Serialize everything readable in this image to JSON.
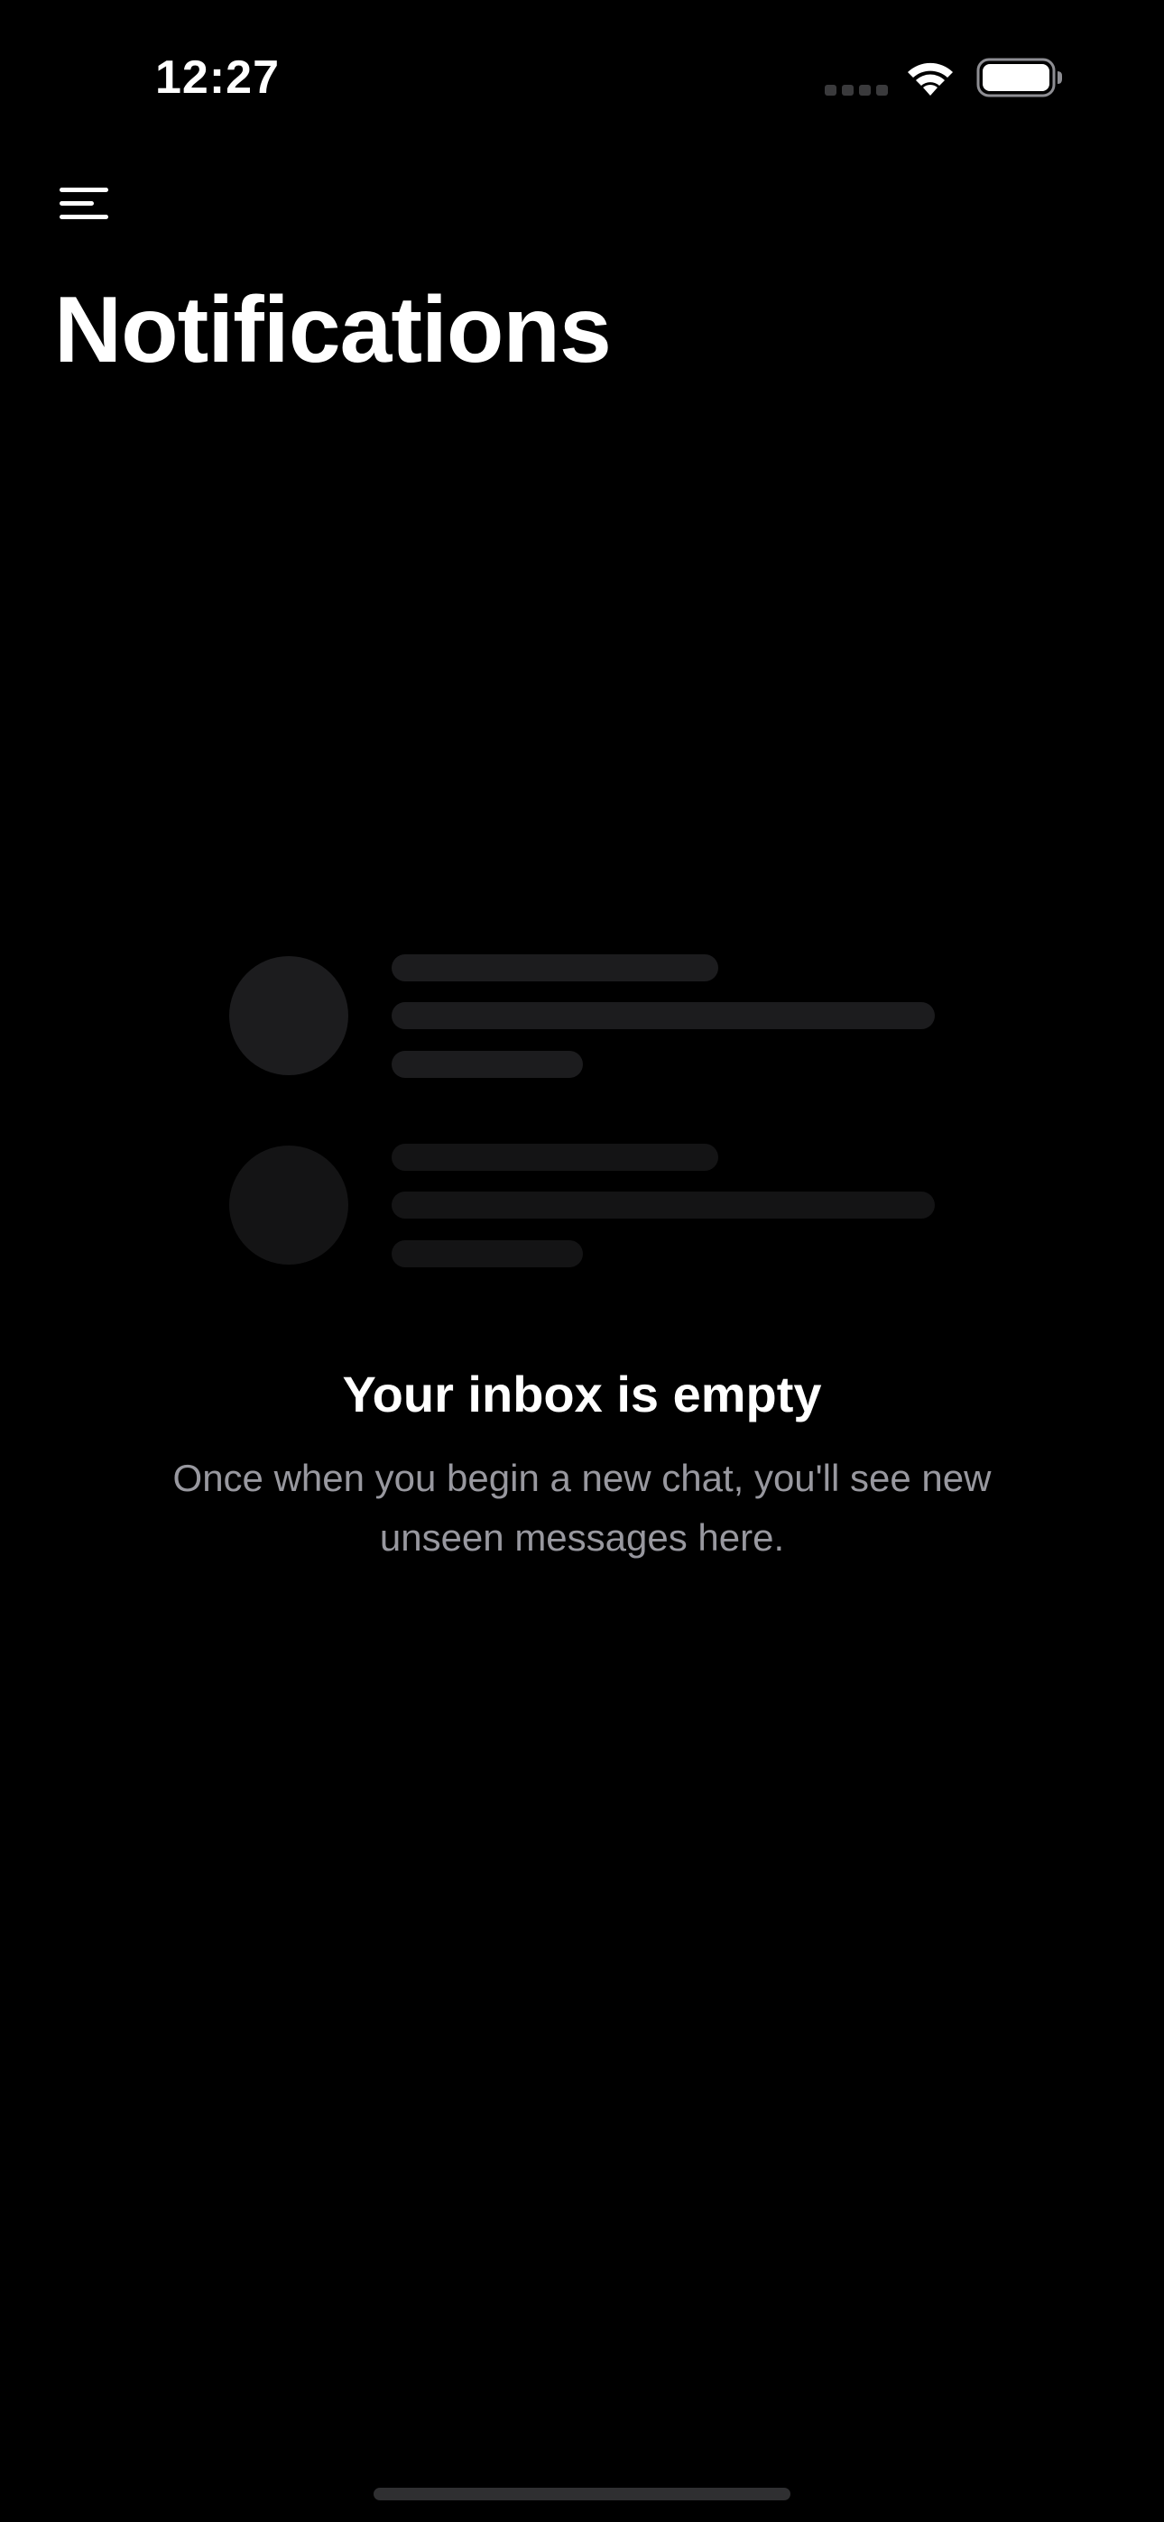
{
  "status_bar": {
    "time": "12:27"
  },
  "header": {
    "menu_icon": "hamburger-menu-icon",
    "title": "Notifications"
  },
  "empty_state": {
    "title": "Your inbox is empty",
    "subtitle": "Once when you begin a new chat, you'll see new unseen messages here."
  },
  "colors": {
    "background": "#000000",
    "text_primary": "#ffffff",
    "text_secondary": "#98989f",
    "placeholder": "#1c1c1e"
  }
}
